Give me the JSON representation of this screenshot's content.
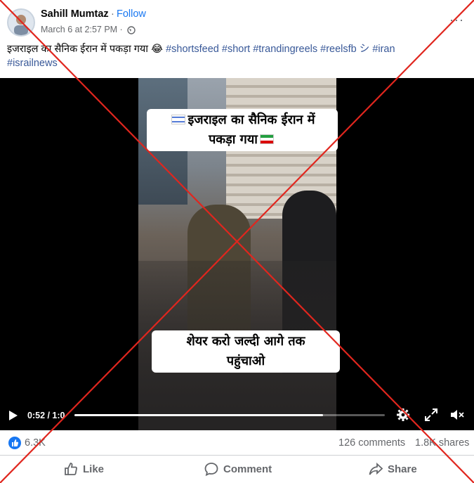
{
  "post": {
    "author": "Sahill Mumtaz",
    "separator": "·",
    "follow_label": "Follow",
    "timestamp": "March 6 at 2:57 PM ·",
    "privacy_icon": "globe-icon",
    "more_label": "···",
    "caption_text": "इजराइल का सैनिक ईरान में पकड़ा गया 😂 ",
    "hashtags": [
      "#shortsfeed",
      "#short",
      "#trandingreels",
      "#reelsfb シ",
      "#iran",
      "#israilnews"
    ]
  },
  "video": {
    "overlay_top_line1": "इजराइल का सैनिक ईरान में",
    "overlay_top_line2": "पकड़ा गया",
    "overlay_bottom_line1": "शेयर करो जल्दी आगे तक",
    "overlay_bottom_line2": "पहुंचाओ",
    "time_label": "0:52 / 1:0",
    "progress_fraction": 0.8,
    "icons": [
      "play-icon",
      "settings-icon",
      "fullscreen-icon",
      "mute-icon"
    ]
  },
  "stats": {
    "likes": "6.3K",
    "comments": "126 comments",
    "shares": "1.8K shares"
  },
  "actions": {
    "like": "Like",
    "comment": "Comment",
    "share": "Share"
  },
  "colors": {
    "accent": "#1877f2",
    "strike": "#e0261e",
    "secondary_text": "#65676b"
  }
}
